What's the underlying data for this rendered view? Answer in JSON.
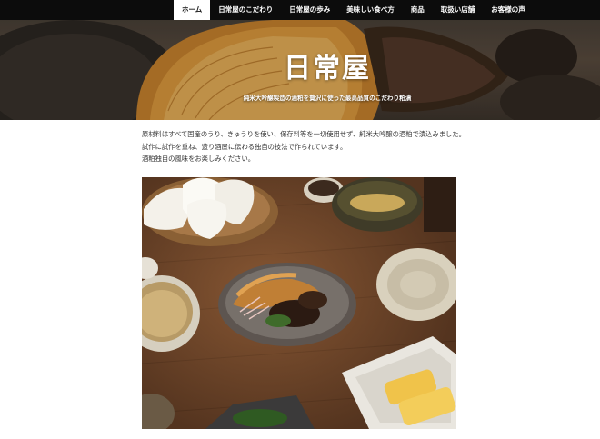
{
  "nav": {
    "items": [
      {
        "label": "ホーム",
        "active": true
      },
      {
        "label": "日常屋のこだわり"
      },
      {
        "label": "日常屋の歩み"
      },
      {
        "label": "美味しい食べ方"
      },
      {
        "label": "商品"
      },
      {
        "label": "取扱い店舗"
      },
      {
        "label": "お客様の声"
      }
    ]
  },
  "hero": {
    "logo_text": "日常屋",
    "tagline": "純米大吟醸製造の酒粕を贅沢に使った最高品質のこだわり粕漬"
  },
  "intro": {
    "lines": [
      "原材料はすべて国産のうり、きゅうりを使い、保存料等を一切使用せず、純米大吟醸の酒粕で漬込みました。",
      "試作に試作を重ね、造り酒屋に伝わる独自の技法で作られています。",
      "酒粕独自の風味をお楽しみください。"
    ]
  },
  "colors": {
    "nav_bg": "#0c0c0c",
    "nav_active_bg": "#ffffff",
    "table_wood": "#5a3a24"
  }
}
